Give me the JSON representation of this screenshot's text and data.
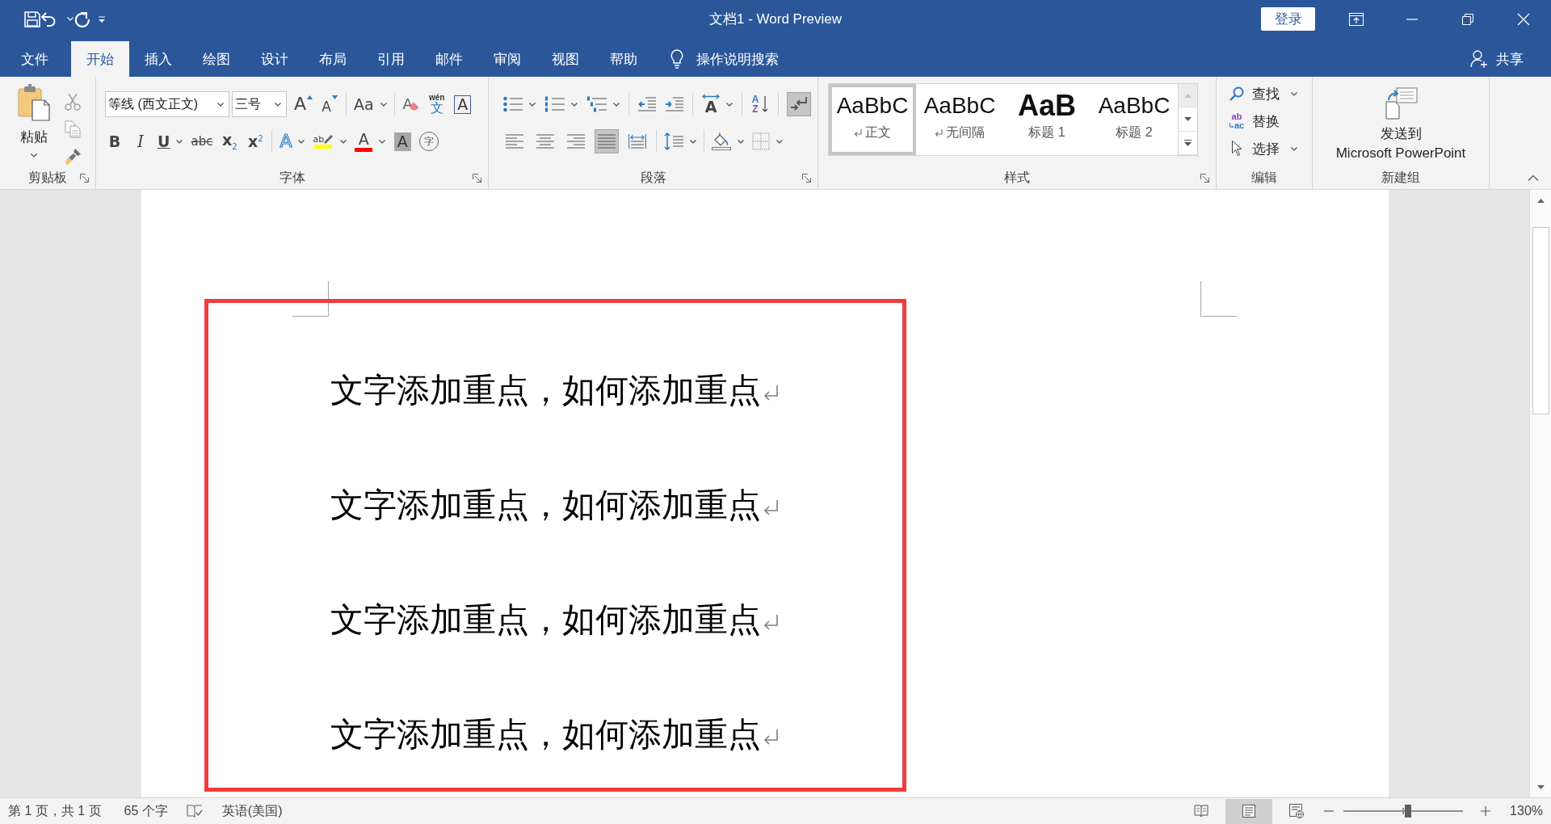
{
  "window": {
    "title": "文档1 - Word Preview",
    "sign_in": "登录"
  },
  "tabs": [
    {
      "label": "文件",
      "selected": false
    },
    {
      "label": "开始",
      "selected": true
    },
    {
      "label": "插入",
      "selected": false
    },
    {
      "label": "绘图",
      "selected": false
    },
    {
      "label": "设计",
      "selected": false
    },
    {
      "label": "布局",
      "selected": false
    },
    {
      "label": "引用",
      "selected": false
    },
    {
      "label": "邮件",
      "selected": false
    },
    {
      "label": "审阅",
      "selected": false
    },
    {
      "label": "视图",
      "selected": false
    },
    {
      "label": "帮助",
      "selected": false
    }
  ],
  "tell_me": "操作说明搜索",
  "share": "共享",
  "ribbon": {
    "clipboard": {
      "label": "剪贴板",
      "paste": "粘贴"
    },
    "font": {
      "label": "字体",
      "font_name": "等线 (西文正文)",
      "font_size": "三号",
      "top_tools": [
        {
          "kind": "grow",
          "text": "A"
        },
        {
          "kind": "shrink",
          "text": "A"
        },
        {
          "kind": "case",
          "text": "Aa"
        },
        {
          "kind": "clear",
          "text": "A"
        },
        {
          "kind": "phonetic",
          "ruby": "wén",
          "text": "文"
        },
        {
          "kind": "border",
          "text": "A"
        }
      ],
      "bottom_tools": [
        {
          "kind": "bold",
          "text": "B"
        },
        {
          "kind": "italic",
          "text": "I"
        },
        {
          "kind": "underline",
          "text": "U"
        },
        {
          "kind": "strike",
          "text": "abc"
        },
        {
          "kind": "subscript",
          "text": "x$_{2}$"
        },
        {
          "kind": "superscript",
          "text": "x$^{2}$"
        },
        {
          "kind": "effects",
          "text": "A"
        },
        {
          "kind": "highlight",
          "text": "ab",
          "color": "#ffff00"
        },
        {
          "kind": "font_color",
          "text": "A",
          "color": "#ff0000"
        },
        {
          "kind": "shading",
          "text": "A"
        },
        {
          "kind": "enclose",
          "text": "字"
        }
      ]
    },
    "paragraph": {
      "label": "段落",
      "direction_text": "A",
      "sort_text": [
        "A",
        "Z"
      ],
      "show_marks": {
        "selected": true
      },
      "alignments": [
        {
          "kind": "left",
          "selected": false
        },
        {
          "kind": "center",
          "selected": false
        },
        {
          "kind": "right",
          "selected": false
        },
        {
          "kind": "justify",
          "selected": true
        },
        {
          "kind": "distributed",
          "selected": false
        }
      ]
    },
    "styles": {
      "label": "样式",
      "scroll_up_disabled": true,
      "gallery": [
        {
          "kind": "normal",
          "preview": "AaBbC",
          "name": "正文",
          "selected": true
        },
        {
          "kind": "no_spacing",
          "preview": "AaBbC",
          "name": "无间隔",
          "selected": false
        },
        {
          "kind": "heading_1",
          "preview": "AaB",
          "name": "标题 1",
          "selected": false
        },
        {
          "kind": "heading_2",
          "preview": "AaBbC",
          "name": "标题 2",
          "selected": false
        }
      ]
    },
    "editing": {
      "label": "编辑",
      "commands": [
        {
          "kind": "find",
          "label": "查找"
        },
        {
          "kind": "replace",
          "label": "替换",
          "icon_text": [
            "ab",
            "ac"
          ]
        },
        {
          "kind": "select",
          "label": "选择"
        }
      ]
    },
    "new_group": {
      "label": "新建组",
      "send": [
        "发送到",
        "Microsoft PowerPoint"
      ]
    }
  },
  "document": {
    "annotation_frame": true,
    "paragraphs": [
      "文字添加重点，如何添加重点",
      "文字添加重点，如何添加重点",
      "文字添加重点，如何添加重点",
      "文字添加重点，如何添加重点"
    ]
  },
  "status_bar": {
    "page": "第 1 页，共 1 页",
    "words": "65 个字",
    "language": "英语(美国)",
    "views": [
      {
        "kind": "read",
        "selected": false
      },
      {
        "kind": "print",
        "selected": true
      },
      {
        "kind": "web",
        "selected": false
      }
    ],
    "zoom": {
      "level": 0.54,
      "reading": "130%"
    }
  }
}
